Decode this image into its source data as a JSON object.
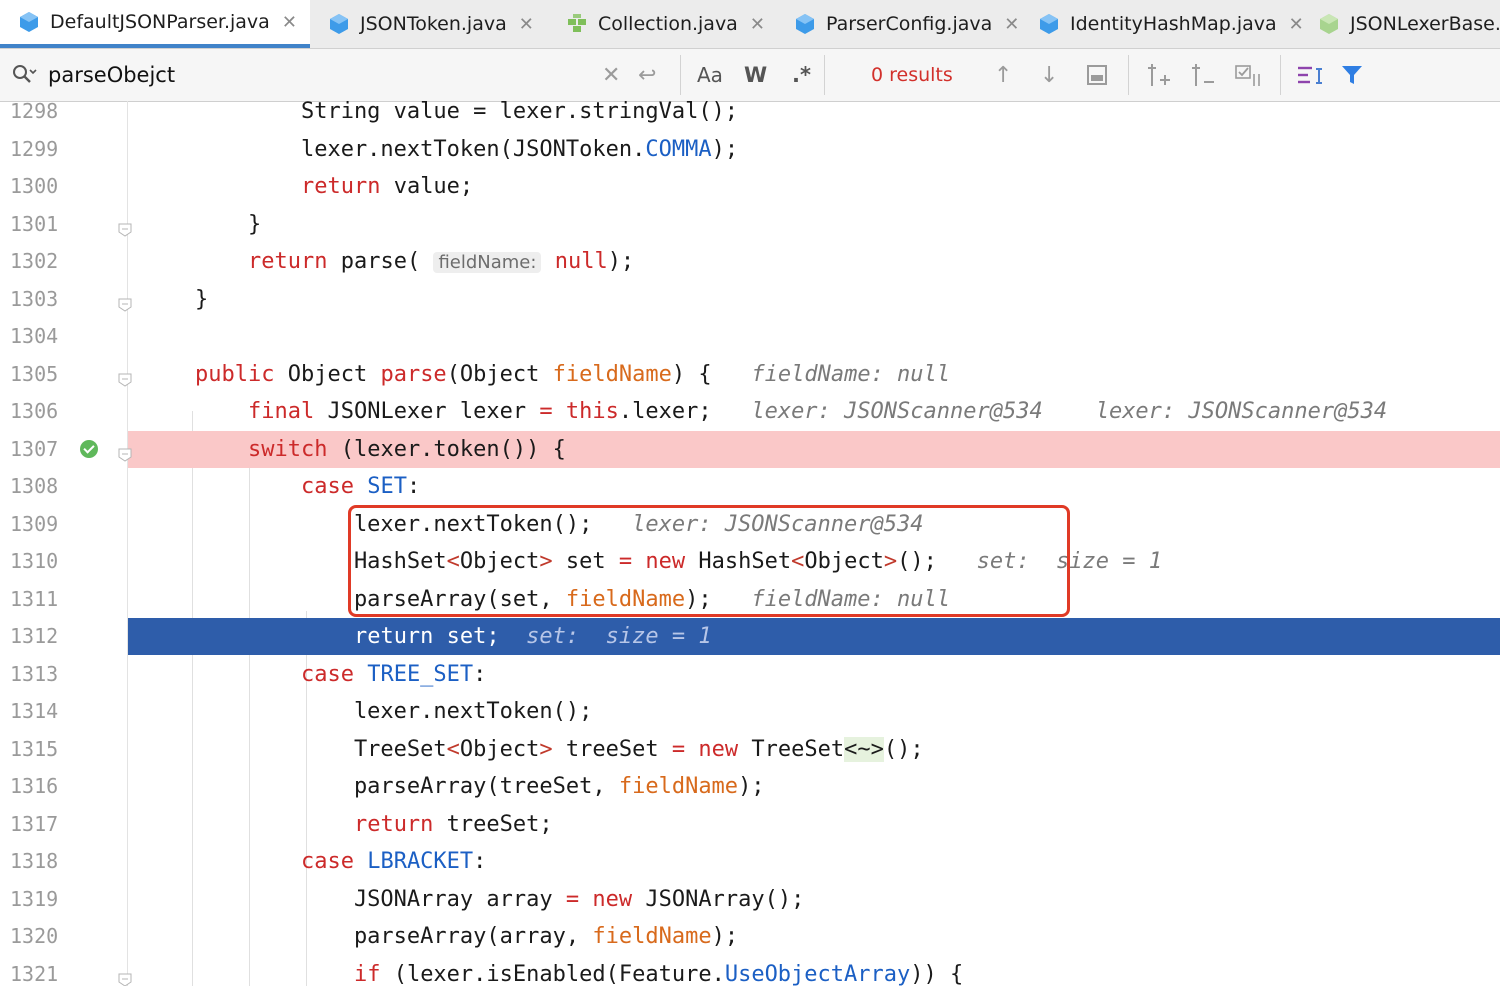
{
  "tabs": [
    {
      "label": "DefaultJSONParser.java",
      "icon": "java-class-icon",
      "active": true
    },
    {
      "label": "JSONToken.java",
      "icon": "java-class-icon"
    },
    {
      "label": "Collection.java",
      "icon": "interface-icon"
    },
    {
      "label": "ParserConfig.java",
      "icon": "java-class-icon"
    },
    {
      "label": "IdentityHashMap.java",
      "icon": "java-class-icon"
    },
    {
      "label": "JSONLexerBase.",
      "icon": "abstract-class-icon"
    }
  ],
  "search": {
    "value": "parseObejct",
    "match_case_label": "Aa",
    "words_label": "W",
    "regex_label": ".*",
    "results": "0 results"
  },
  "lines": [
    {
      "n": "1298",
      "code": [
        {
          "t": "        String value = lexer.stringVal();"
        }
      ]
    },
    {
      "n": "1299",
      "code": [
        {
          "t": "        lexer.nextToken(JSONToken."
        },
        {
          "t": "COMMA",
          "c": "fd"
        },
        {
          "t": ");"
        }
      ]
    },
    {
      "n": "1300",
      "code": [
        {
          "t": "        "
        },
        {
          "t": "return",
          "c": "kw"
        },
        {
          "t": " value;"
        }
      ]
    },
    {
      "n": "1301",
      "code": [
        {
          "t": "    }"
        }
      ]
    },
    {
      "n": "1302",
      "code": [
        {
          "t": "    "
        },
        {
          "t": "return",
          "c": "kw"
        },
        {
          "t": " parse( "
        },
        {
          "t": "fieldName:",
          "c": "ph"
        },
        {
          "t": " "
        },
        {
          "t": "null",
          "c": "kw"
        },
        {
          "t": ");"
        }
      ]
    },
    {
      "n": "1303",
      "code": [
        {
          "t": "}"
        }
      ]
    },
    {
      "n": "1304",
      "code": [
        {
          "t": ""
        }
      ]
    },
    {
      "n": "1305",
      "code": [
        {
          "t": "public",
          "c": "kw"
        },
        {
          "t": " Object "
        },
        {
          "t": "parse",
          "c": "kw"
        },
        {
          "t": "(Object "
        },
        {
          "t": "fieldName",
          "c": "pr"
        },
        {
          "t": ") {   "
        },
        {
          "t": "fieldName: null",
          "c": "hint"
        }
      ]
    },
    {
      "n": "1306",
      "code": [
        {
          "t": "    "
        },
        {
          "t": "final",
          "c": "kw"
        },
        {
          "t": " JSONLexer lexer "
        },
        {
          "t": "=",
          "c": "kw"
        },
        {
          "t": " "
        },
        {
          "t": "this",
          "c": "kw"
        },
        {
          "t": ".lexer;   "
        },
        {
          "t": "lexer: JSONScanner@534    lexer: JSONScanner@534",
          "c": "hint"
        }
      ]
    },
    {
      "n": "1307",
      "code": [
        {
          "t": "    "
        },
        {
          "t": "switch",
          "c": "kw"
        },
        {
          "t": " (lexer.token()) {"
        }
      ]
    },
    {
      "n": "1308",
      "code": [
        {
          "t": "        "
        },
        {
          "t": "case",
          "c": "kw"
        },
        {
          "t": " "
        },
        {
          "t": "SET",
          "c": "fd"
        },
        {
          "t": ":"
        }
      ]
    },
    {
      "n": "1309",
      "code": [
        {
          "t": "            lexer.nextToken();   "
        },
        {
          "t": "lexer: JSONScanner@534",
          "c": "hint"
        }
      ]
    },
    {
      "n": "1310",
      "code": [
        {
          "t": "            HashSet"
        },
        {
          "t": "<",
          "c": "gen"
        },
        {
          "t": "Object"
        },
        {
          "t": ">",
          "c": "gen"
        },
        {
          "t": " set "
        },
        {
          "t": "=",
          "c": "kw"
        },
        {
          "t": " "
        },
        {
          "t": "new",
          "c": "kw"
        },
        {
          "t": " HashSet"
        },
        {
          "t": "<",
          "c": "gen"
        },
        {
          "t": "Object"
        },
        {
          "t": ">",
          "c": "gen"
        },
        {
          "t": "();   "
        },
        {
          "t": "set:  size = 1",
          "c": "hint"
        }
      ]
    },
    {
      "n": "1311",
      "code": [
        {
          "t": "            parseArray(set, "
        },
        {
          "t": "fieldName",
          "c": "pr"
        },
        {
          "t": ");   "
        },
        {
          "t": "fieldName: null",
          "c": "hint"
        }
      ]
    },
    {
      "n": "1312",
      "code": [
        {
          "t": "            "
        },
        {
          "t": "return",
          "c": "kw"
        },
        {
          "t": " set;  "
        },
        {
          "t": "set:  size = 1",
          "c": "hint"
        }
      ]
    },
    {
      "n": "1313",
      "code": [
        {
          "t": "        "
        },
        {
          "t": "case",
          "c": "kw"
        },
        {
          "t": " "
        },
        {
          "t": "TREE_SET",
          "c": "fd"
        },
        {
          "t": ":"
        }
      ]
    },
    {
      "n": "1314",
      "code": [
        {
          "t": "            lexer.nextToken();"
        }
      ]
    },
    {
      "n": "1315",
      "code": [
        {
          "t": "            TreeSet"
        },
        {
          "t": "<",
          "c": "gen"
        },
        {
          "t": "Object"
        },
        {
          "t": ">",
          "c": "gen"
        },
        {
          "t": " treeSet "
        },
        {
          "t": "=",
          "c": "kw"
        },
        {
          "t": " "
        },
        {
          "t": "new",
          "c": "kw"
        },
        {
          "t": " TreeSet"
        },
        {
          "t": "<~>",
          "c": "dia"
        },
        {
          "t": "();"
        }
      ]
    },
    {
      "n": "1316",
      "code": [
        {
          "t": "            parseArray(treeSet, "
        },
        {
          "t": "fieldName",
          "c": "pr"
        },
        {
          "t": ");"
        }
      ]
    },
    {
      "n": "1317",
      "code": [
        {
          "t": "            "
        },
        {
          "t": "return",
          "c": "kw"
        },
        {
          "t": " treeSet;"
        }
      ]
    },
    {
      "n": "1318",
      "code": [
        {
          "t": "        "
        },
        {
          "t": "case",
          "c": "kw"
        },
        {
          "t": " "
        },
        {
          "t": "LBRACKET",
          "c": "fd"
        },
        {
          "t": ":"
        }
      ]
    },
    {
      "n": "1319",
      "code": [
        {
          "t": "            JSONArray array "
        },
        {
          "t": "=",
          "c": "kw"
        },
        {
          "t": " "
        },
        {
          "t": "new",
          "c": "kw"
        },
        {
          "t": " JSONArray();"
        }
      ]
    },
    {
      "n": "1320",
      "code": [
        {
          "t": "            parseArray(array, "
        },
        {
          "t": "fieldName",
          "c": "pr"
        },
        {
          "t": ");"
        }
      ]
    },
    {
      "n": "1321",
      "code": [
        {
          "t": "            "
        },
        {
          "t": "if",
          "c": "kw"
        },
        {
          "t": " (lexer.isEnabled(Feature."
        },
        {
          "t": "UseObjectArray",
          "c": "fd"
        },
        {
          "t": ")) {"
        }
      ]
    }
  ],
  "breakpoint_line": "1307",
  "current_line": "1312",
  "colors": {
    "breakpoint": "#fac8c8",
    "current": "#2e5daa",
    "keyword": "#cc2a2a",
    "field": "#1b5fc4",
    "param": "#d86a1c",
    "annotation": "#e03a26"
  }
}
